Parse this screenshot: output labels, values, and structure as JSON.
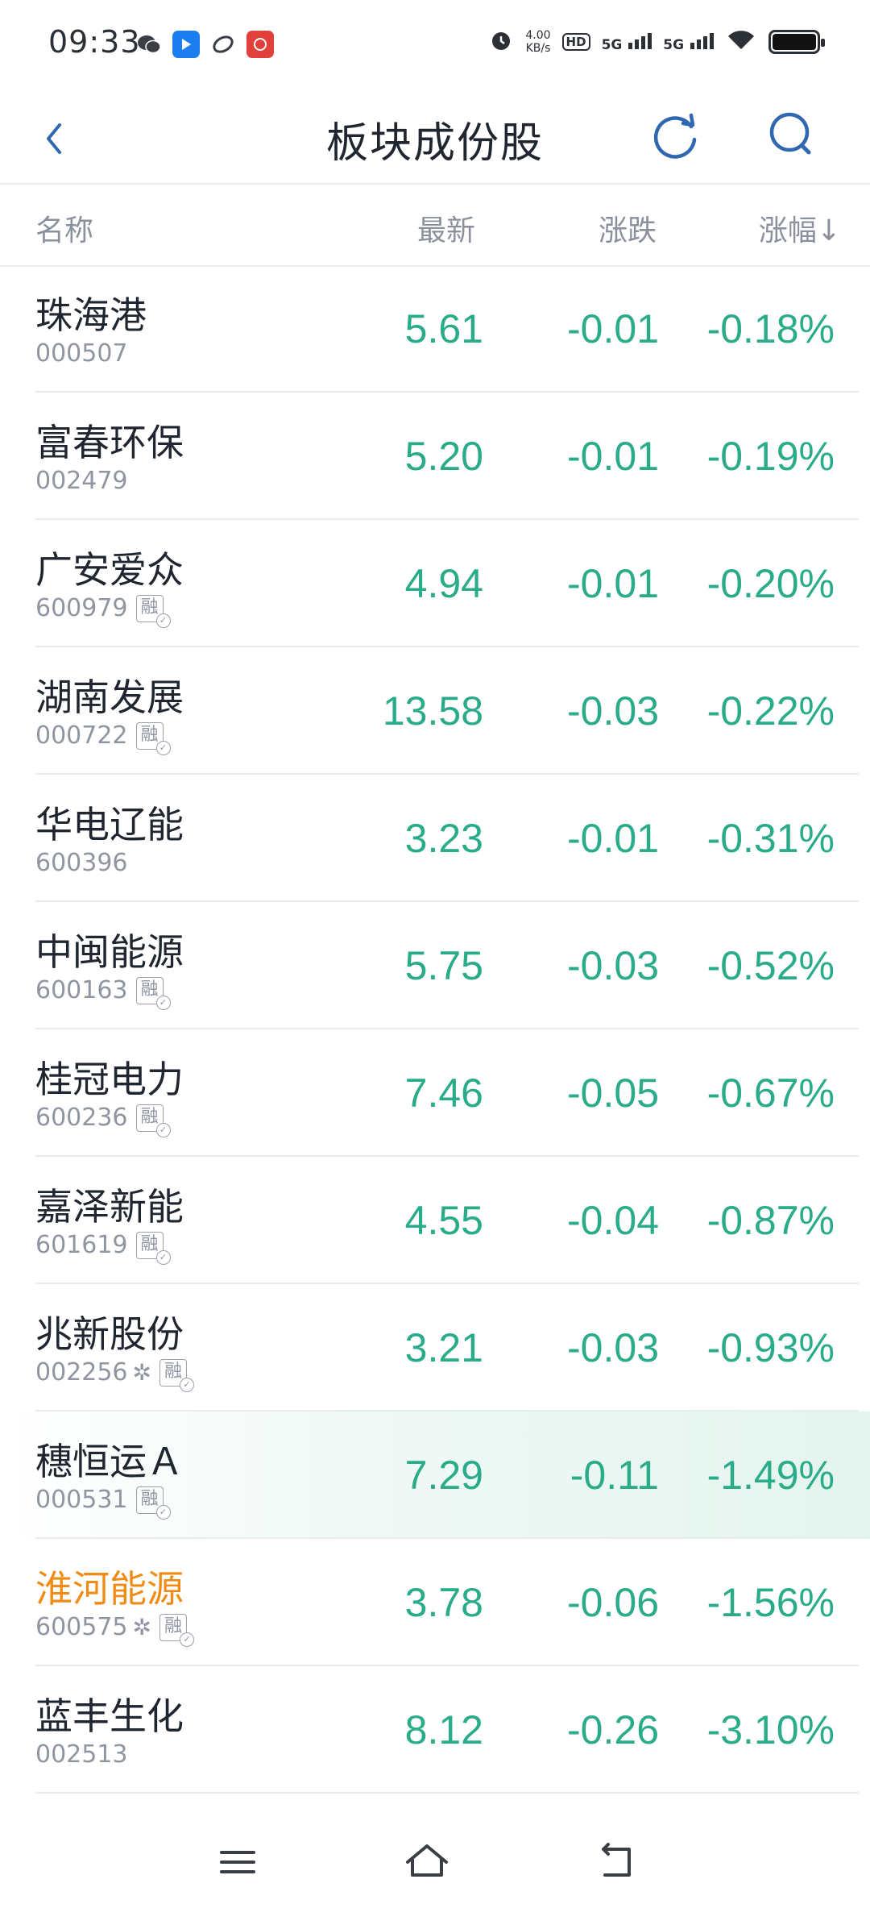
{
  "status_bar": {
    "time": "09:33",
    "speed_value": "4.00",
    "speed_unit": "KB/s",
    "hd_label": "HD",
    "hd_sub": "1 2",
    "net1": "5G",
    "net2": "5G"
  },
  "header": {
    "title": "板块成份股"
  },
  "columns": {
    "name": "名称",
    "price": "最新",
    "change": "涨跌",
    "pct": "涨幅↓"
  },
  "badge_label": "融",
  "stocks": [
    {
      "name": "珠海港",
      "code": "000507",
      "price": "5.61",
      "change": "-0.01",
      "pct": "-0.18%",
      "rong": false,
      "gear": false
    },
    {
      "name": "富春环保",
      "code": "002479",
      "price": "5.20",
      "change": "-0.01",
      "pct": "-0.19%",
      "rong": false,
      "gear": false
    },
    {
      "name": "广安爱众",
      "code": "600979",
      "price": "4.94",
      "change": "-0.01",
      "pct": "-0.20%",
      "rong": true,
      "gear": false
    },
    {
      "name": "湖南发展",
      "code": "000722",
      "price": "13.58",
      "change": "-0.03",
      "pct": "-0.22%",
      "rong": true,
      "gear": false
    },
    {
      "name": "华电辽能",
      "code": "600396",
      "price": "3.23",
      "change": "-0.01",
      "pct": "-0.31%",
      "rong": false,
      "gear": false
    },
    {
      "name": "中闽能源",
      "code": "600163",
      "price": "5.75",
      "change": "-0.03",
      "pct": "-0.52%",
      "rong": true,
      "gear": false
    },
    {
      "name": "桂冠电力",
      "code": "600236",
      "price": "7.46",
      "change": "-0.05",
      "pct": "-0.67%",
      "rong": true,
      "gear": false
    },
    {
      "name": "嘉泽新能",
      "code": "601619",
      "price": "4.55",
      "change": "-0.04",
      "pct": "-0.87%",
      "rong": true,
      "gear": false
    },
    {
      "name": "兆新股份",
      "code": "002256",
      "price": "3.21",
      "change": "-0.03",
      "pct": "-0.93%",
      "rong": true,
      "gear": true
    },
    {
      "name": "穗恒运Ａ",
      "code": "000531",
      "price": "7.29",
      "change": "-0.11",
      "pct": "-1.49%",
      "rong": true,
      "gear": false,
      "highlight": true
    },
    {
      "name": "淮河能源",
      "code": "600575",
      "price": "3.78",
      "change": "-0.06",
      "pct": "-1.56%",
      "rong": true,
      "gear": true,
      "orange": true
    },
    {
      "name": "蓝丰生化",
      "code": "002513",
      "price": "8.12",
      "change": "-0.26",
      "pct": "-3.10%",
      "rong": false,
      "gear": false
    }
  ],
  "colors": {
    "down_green": "#2aab89",
    "accent_blue": "#2f67b1",
    "orange_name": "#f08c16"
  },
  "icons": {
    "back": "chevron-left-icon",
    "refresh": "refresh-icon",
    "search": "search-icon",
    "menu": "menu-icon",
    "home": "home-icon",
    "nav_back": "back-arrow-icon"
  }
}
